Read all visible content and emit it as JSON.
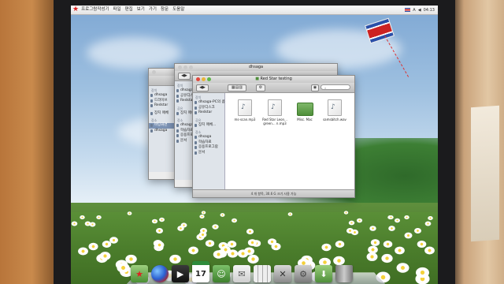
{
  "menubar": {
    "apple_icon": "red-star-icon",
    "items": [
      "프로그람작성기",
      "파일",
      "편집",
      "보기",
      "가기",
      "창문",
      "도움말"
    ],
    "clock": "04:13"
  },
  "windows": {
    "back": {
      "title": "",
      "sidebar": {
        "sections": [
          {
            "head": "장치",
            "items": [
              "dhsaga",
              "드라이브",
              "Redstar"
            ]
          },
          {
            "head": "",
            "items": [
              "장치 매체"
            ]
          },
          {
            "head": "장소",
            "items": [
              "바탕화면",
              "dhsaga"
            ]
          }
        ]
      }
    },
    "middle": {
      "title": "dhsaga",
      "sidebar": {
        "sections": [
          {
            "head": "장치",
            "items": [
              "dhsaga-PC의 콤퓨터",
              "공유디스크",
              "Redstar"
            ]
          },
          {
            "head": "공유",
            "items": [
              "장치 매체"
            ]
          },
          {
            "head": "장소",
            "items": [
              "dhsaga",
              "학습자료",
              "응용프로그람",
              "문서"
            ]
          }
        ]
      }
    },
    "front": {
      "title": "Red Star testing",
      "search_placeholder": "",
      "sidebar": {
        "sections": [
          {
            "head": "장치",
            "items": [
              "dhsaga-PC의 콤퓨터",
              "공유디스크",
              "Redstar"
            ]
          },
          {
            "head": "공유",
            "items": [
              "장치 매체..."
            ]
          },
          {
            "head": "장소",
            "items": [
              "dhsaga",
              "학습자료",
              "응용프로그람",
              "문서"
            ]
          }
        ]
      },
      "files": [
        {
          "name": "ms-scan.mp3",
          "kind": "audio"
        },
        {
          "name": "Red Star Leon... green... n.mp3",
          "kind": "audio"
        },
        {
          "name": "Misc. Mac",
          "kind": "folder"
        },
        {
          "name": "samsbitch.wav",
          "kind": "audio"
        }
      ],
      "status": "4 개 항목, 30.6 G 크기 사용 가능"
    }
  },
  "dock": {
    "items": [
      {
        "name": "finder",
        "icon": "red-star-folder-icon"
      },
      {
        "name": "browser",
        "icon": "globe-icon"
      },
      {
        "name": "media",
        "icon": "film-icon"
      },
      {
        "name": "calendar",
        "icon": "calendar-icon",
        "text": "17"
      },
      {
        "name": "contacts",
        "icon": "contacts-icon"
      },
      {
        "name": "mail",
        "icon": "mail-icon"
      },
      {
        "name": "calculator",
        "icon": "calculator-icon"
      },
      {
        "name": "utilities",
        "icon": "tools-icon"
      },
      {
        "name": "settings",
        "icon": "gear-icon"
      },
      {
        "name": "downloads",
        "icon": "download-folder-icon"
      },
      {
        "name": "trash",
        "icon": "trash-icon"
      }
    ]
  },
  "colors": {
    "accent": "#7c93b5",
    "star": "#dd2222",
    "sidebar_bg": "#dfe4ea"
  }
}
